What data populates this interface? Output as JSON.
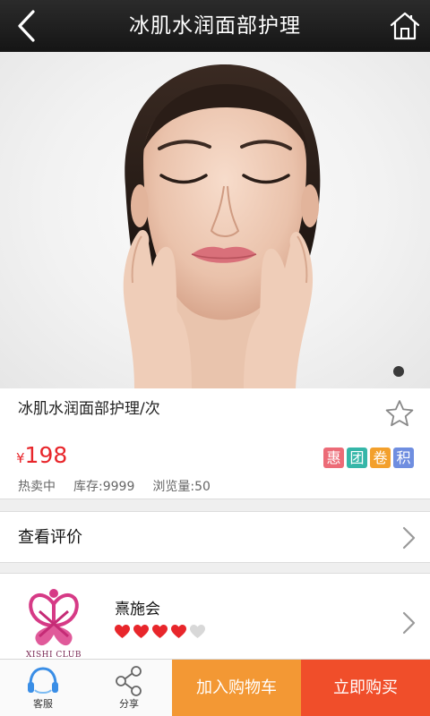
{
  "header": {
    "title": "冰肌水润面部护理",
    "back_icon": "chevron-left-icon",
    "home_icon": "home-icon"
  },
  "hero": {
    "image": "woman-face-closed-eyes-hands-on-cheeks",
    "pager_dots": 1,
    "active_dot": 0
  },
  "product": {
    "name": "冰肌水润面部护理/次",
    "price_currency": "¥",
    "price_value": "198",
    "tags": [
      {
        "label": "惠",
        "color": "#ec6b77"
      },
      {
        "label": "团",
        "color": "#35b6a8"
      },
      {
        "label": "卷",
        "color": "#f3a02c"
      },
      {
        "label": "积",
        "color": "#6f8ee0"
      }
    ],
    "meta": {
      "hot": "热卖中",
      "stock": "库存:9999",
      "views": "浏览量:50"
    },
    "favorite_icon": "star-outline-icon"
  },
  "reviews": {
    "label": "查看评价"
  },
  "store": {
    "name": "熹施会",
    "logo_text": "XISHI CLUB",
    "rating_filled": 4,
    "rating_total": 5,
    "heart_color": "#e8262b",
    "heart_empty_color": "#d8d8d8"
  },
  "bottom_bar": {
    "service_label": "客服",
    "share_label": "分享",
    "add_to_cart": "加入购物车",
    "buy_now": "立即购买",
    "cart_color": "#f39834",
    "buy_color": "#f04e2a"
  }
}
